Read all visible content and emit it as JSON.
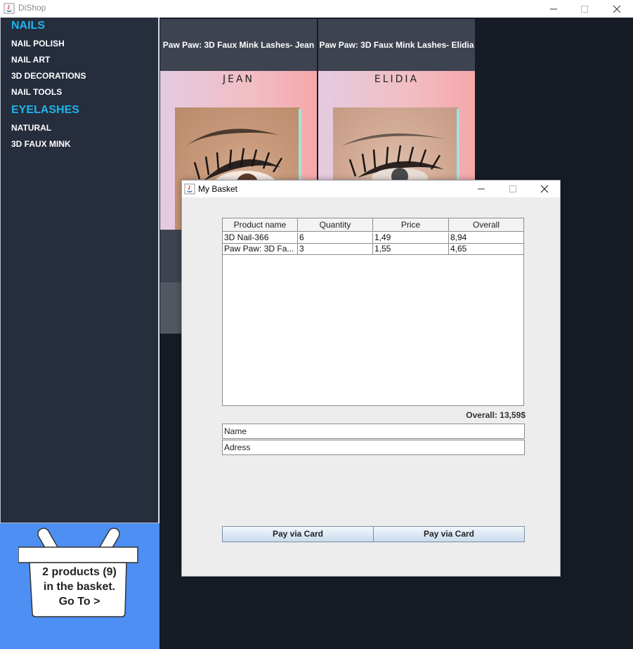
{
  "window": {
    "title": "DiShop",
    "icons": {
      "app": "java-cup-icon",
      "minimize": "minimize-icon",
      "maximize": "maximize-icon",
      "close": "close-icon"
    }
  },
  "sidebar": {
    "categories": [
      {
        "label": "NAILS",
        "items": [
          "NAIL POLISH",
          "NAIL ART",
          "3D DECORATIONS",
          "NAIL TOOLS"
        ]
      },
      {
        "label": "EYELASHES",
        "items": [
          "NATURAL",
          "3D FAUX MINK"
        ]
      }
    ]
  },
  "basket_panel": {
    "line1": "2 products (9)",
    "line2": "in the basket.",
    "line3": "Go To >",
    "icon": "basket-icon"
  },
  "products": [
    {
      "title": "Paw Paw: 3D Faux Mink Lashes- Jean",
      "brand": "JEAN"
    },
    {
      "title": "Paw Paw: 3D Faux Mink Lashes- Elidia",
      "brand": "ELIDIA"
    }
  ],
  "dialog": {
    "title": "My Basket",
    "table": {
      "headers": [
        "Product name",
        "Quantity",
        "Price",
        "Overall"
      ],
      "rows": [
        [
          "3D Nail-366",
          "6",
          "1,49",
          "8,94"
        ],
        [
          "Paw Paw: 3D Fa...",
          "3",
          "1,55",
          "4,65"
        ]
      ]
    },
    "overall": "Overall: 13,59$",
    "name_field": "Name",
    "address_field": "Adress",
    "pay_button_1": "Pay via Card",
    "pay_button_2": "Pay via Card"
  },
  "colors": {
    "sidebar_bg": "#262d3d",
    "category_accent": "#1eb4e9",
    "basket_panel_bg": "#4d8ff2",
    "content_bg": "#161b26"
  }
}
